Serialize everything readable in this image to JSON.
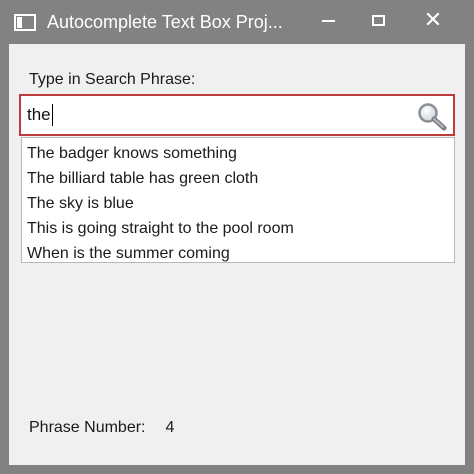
{
  "window": {
    "title": "Autocomplete Text Box Proj..."
  },
  "search": {
    "label": "Type in Search Phrase:",
    "value": "the"
  },
  "suggestions": [
    "The badger knows something",
    "The billiard table has green cloth",
    "The sky is blue",
    "This is going straight to the pool room",
    "When is the summer coming"
  ],
  "phrase": {
    "label": "Phrase Number:",
    "value": "4"
  },
  "colors": {
    "titlebar": "#828282",
    "search_border": "#c0393b",
    "client_background": "#f0f0f0"
  },
  "icons": {
    "app": "app-icon",
    "search": "magnifier-icon",
    "minimize": "minimize-icon",
    "maximize": "maximize-icon",
    "close": "close-icon"
  }
}
